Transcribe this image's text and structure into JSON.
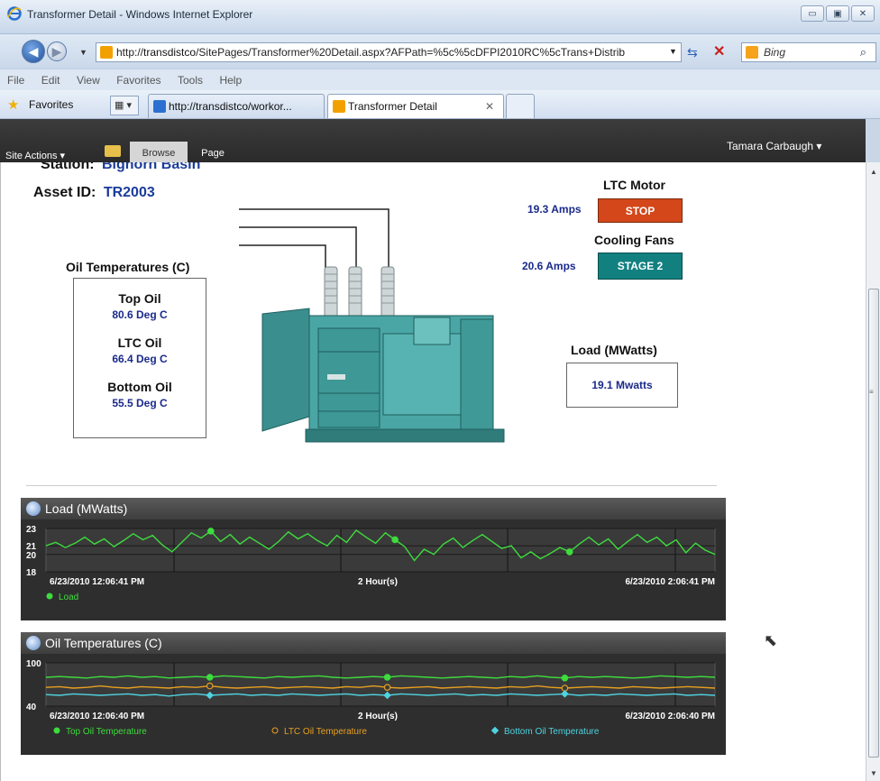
{
  "window": {
    "title": "Transformer Detail - Windows Internet Explorer",
    "minimize": "▭",
    "maximize": "▣",
    "close": "✕"
  },
  "navigation": {
    "address_prefix": "http://",
    "address_host": "transdistco",
    "address_path": "/SitePages/Transformer%20Detail.aspx?AFPath=%5c%5cDFPI2010RC%5cTrans+Distrib",
    "search_placeholder": "Bing"
  },
  "menu": [
    "File",
    "Edit",
    "View",
    "Favorites",
    "Tools",
    "Help"
  ],
  "favorites": {
    "label": "Favorites",
    "tabs": [
      {
        "label": "http://transdistco/workor...",
        "active": false
      },
      {
        "label": "Transformer Detail",
        "active": true
      }
    ]
  },
  "ribbon": {
    "site_actions": "Site Actions ▾",
    "tabs": [
      "Browse",
      "Page"
    ],
    "user": "Tamara Carbaugh ▾"
  },
  "asset": {
    "station_label": "Station:",
    "station_value": "Bighorn Basin",
    "asset_label": "Asset ID:",
    "asset_value": "TR2003"
  },
  "oil": {
    "title": "Oil Temperatures (C)",
    "readings": [
      {
        "label": "Top Oil",
        "value": "80.6 Deg C"
      },
      {
        "label": "LTC Oil",
        "value": "66.4 Deg C"
      },
      {
        "label": "Bottom Oil",
        "value": "55.5 Deg C"
      }
    ]
  },
  "ltc_motor": {
    "title": "LTC Motor",
    "amps": "19.3 Amps",
    "status": "STOP",
    "color": "#d3471a"
  },
  "cooling_fans": {
    "title": "Cooling Fans",
    "amps": "20.6 Amps",
    "status": "STAGE 2",
    "color": "#138080"
  },
  "load": {
    "title": "Load (MWatts)",
    "value": "19.1 Mwatts"
  },
  "chart_data": [
    {
      "type": "line",
      "title": "Load (MWatts)",
      "y_ticks": [
        "23",
        "21",
        "20",
        "18"
      ],
      "ylim": [
        18,
        23
      ],
      "x_start": "6/23/2010 12:06:41 PM",
      "x_end": "6/23/2010 2:06:41 PM",
      "x_span": "2 Hour(s)",
      "series": [
        {
          "name": "Load",
          "color": "#3ddc3d",
          "values": [
            21.0,
            21.4,
            20.8,
            21.3,
            22.0,
            21.2,
            21.8,
            20.9,
            21.6,
            22.4,
            21.7,
            22.2,
            21.1,
            20.3,
            21.4,
            22.5,
            21.9,
            22.7,
            21.5,
            22.3,
            21.2,
            22.0,
            21.3,
            20.6,
            21.5,
            22.6,
            21.8,
            22.4,
            21.6,
            21.0,
            22.2,
            21.4,
            22.8,
            22.0,
            21.3,
            22.5,
            21.7,
            20.9,
            19.3,
            20.6,
            20.0,
            21.2,
            21.9,
            20.8,
            21.6,
            22.3,
            21.5,
            20.7,
            21.0,
            19.6,
            20.3,
            19.5,
            20.1,
            20.8,
            20.3,
            21.2,
            22.0,
            21.1,
            21.8,
            20.6,
            21.5,
            22.3,
            21.4,
            22.0,
            21.0,
            21.7,
            20.2,
            21.3,
            20.5,
            20.0
          ]
        }
      ]
    },
    {
      "type": "line",
      "title": "Oil Temperatures (C)",
      "y_ticks": [
        "100",
        "40"
      ],
      "ylim": [
        40,
        100
      ],
      "x_start": "6/23/2010 12:06:40 PM",
      "x_end": "6/23/2010 2:06:40 PM",
      "x_span": "2 Hour(s)",
      "series": [
        {
          "name": "Top Oil Temperature",
          "color": "#3ddc3d",
          "marker": "●",
          "values": [
            80,
            81,
            80,
            79,
            81,
            80,
            82,
            80,
            81,
            79,
            80,
            81,
            80,
            82,
            81,
            80,
            79,
            81,
            80,
            81,
            82,
            80,
            79,
            80,
            81,
            80,
            82,
            81,
            80,
            79,
            80,
            81,
            80,
            79,
            81,
            80,
            82,
            80,
            79,
            81,
            80,
            81,
            80,
            79,
            80,
            82,
            81,
            80,
            81,
            80
          ]
        },
        {
          "name": "LTC Oil Temperature",
          "color": "#e8a020",
          "marker": "○",
          "values": [
            66,
            67,
            65,
            66,
            68,
            66,
            65,
            67,
            66,
            65,
            67,
            66,
            68,
            66,
            65,
            66,
            67,
            65,
            66,
            67,
            66,
            65,
            67,
            66,
            68,
            66,
            65,
            66,
            67,
            65,
            66,
            67,
            66,
            65,
            67,
            66,
            68,
            66,
            65,
            66,
            67,
            66,
            65,
            67,
            66,
            65,
            66,
            67,
            66,
            65
          ]
        },
        {
          "name": "Bottom Oil Temperature",
          "color": "#4fd3e0",
          "marker": "◆",
          "values": [
            56,
            55,
            57,
            56,
            55,
            56,
            57,
            55,
            56,
            54,
            56,
            57,
            55,
            56,
            57,
            55,
            56,
            55,
            57,
            56,
            55,
            56,
            57,
            55,
            56,
            55,
            57,
            56,
            55,
            56,
            57,
            55,
            56,
            55,
            57,
            56,
            55,
            56,
            57,
            55,
            56,
            55,
            57,
            56,
            55,
            56,
            57,
            55,
            56,
            55
          ]
        }
      ]
    }
  ]
}
